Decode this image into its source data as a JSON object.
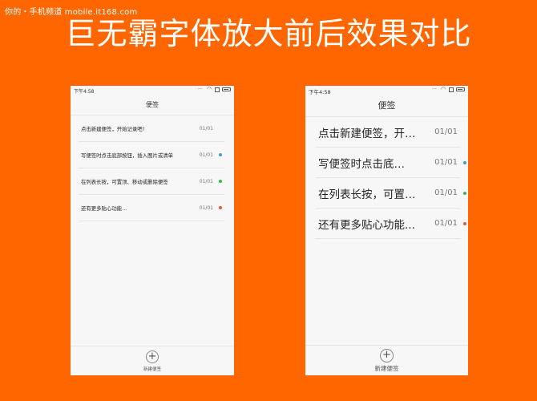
{
  "watermark": "你的・手机频道 mobile.it168.com",
  "headline": "巨无霸字体放大前后效果对比",
  "app": {
    "time": "下午4:58",
    "title": "便签",
    "add_label": "新建便签",
    "add_icon": "plus-icon",
    "status_icons": [
      "signal-icon",
      "wifi-icon",
      "sim-icon",
      "battery-icon"
    ]
  },
  "before": {
    "notes": [
      {
        "text": "点击新建便签，开始记录吧！",
        "date": "01/01",
        "dot": null
      },
      {
        "text": "写便签时点击底部按钮，插入图片或清单",
        "date": "01/01",
        "dot": "#3a9fd8"
      },
      {
        "text": "在列表长按，可置顶、移动或删除便签",
        "date": "01/01",
        "dot": "#3cb84a"
      },
      {
        "text": "还有更多贴心功能...",
        "date": "01/01",
        "dot": "#e8593a"
      }
    ]
  },
  "after": {
    "notes": [
      {
        "text": "点击新建便签，开…",
        "date": "01/01",
        "dot": null
      },
      {
        "text": "写便签时点击底…",
        "date": "01/01",
        "dot": "#3a9fd8"
      },
      {
        "text": "在列表长按，可置…",
        "date": "01/01",
        "dot": "#3cb84a"
      },
      {
        "text": "还有更多贴心功能...",
        "date": "01/01",
        "dot": "#e8593a"
      }
    ]
  }
}
